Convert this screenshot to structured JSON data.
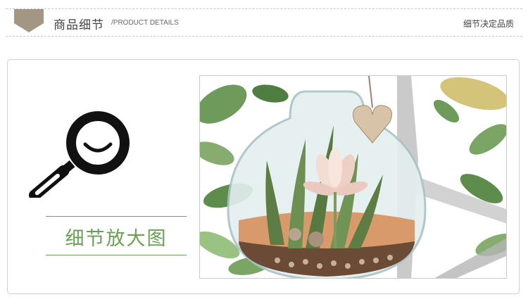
{
  "header": {
    "title": "商品细节",
    "subtitle": "/PRODUCT DETAILS",
    "right_text": "细节决定品质",
    "badge_color": "#a39683"
  },
  "main": {
    "label": "细节放大图",
    "accent_color": "#69a054",
    "icon": "magnifier-icon"
  },
  "photo": {
    "subject": "terrarium-illustration"
  }
}
